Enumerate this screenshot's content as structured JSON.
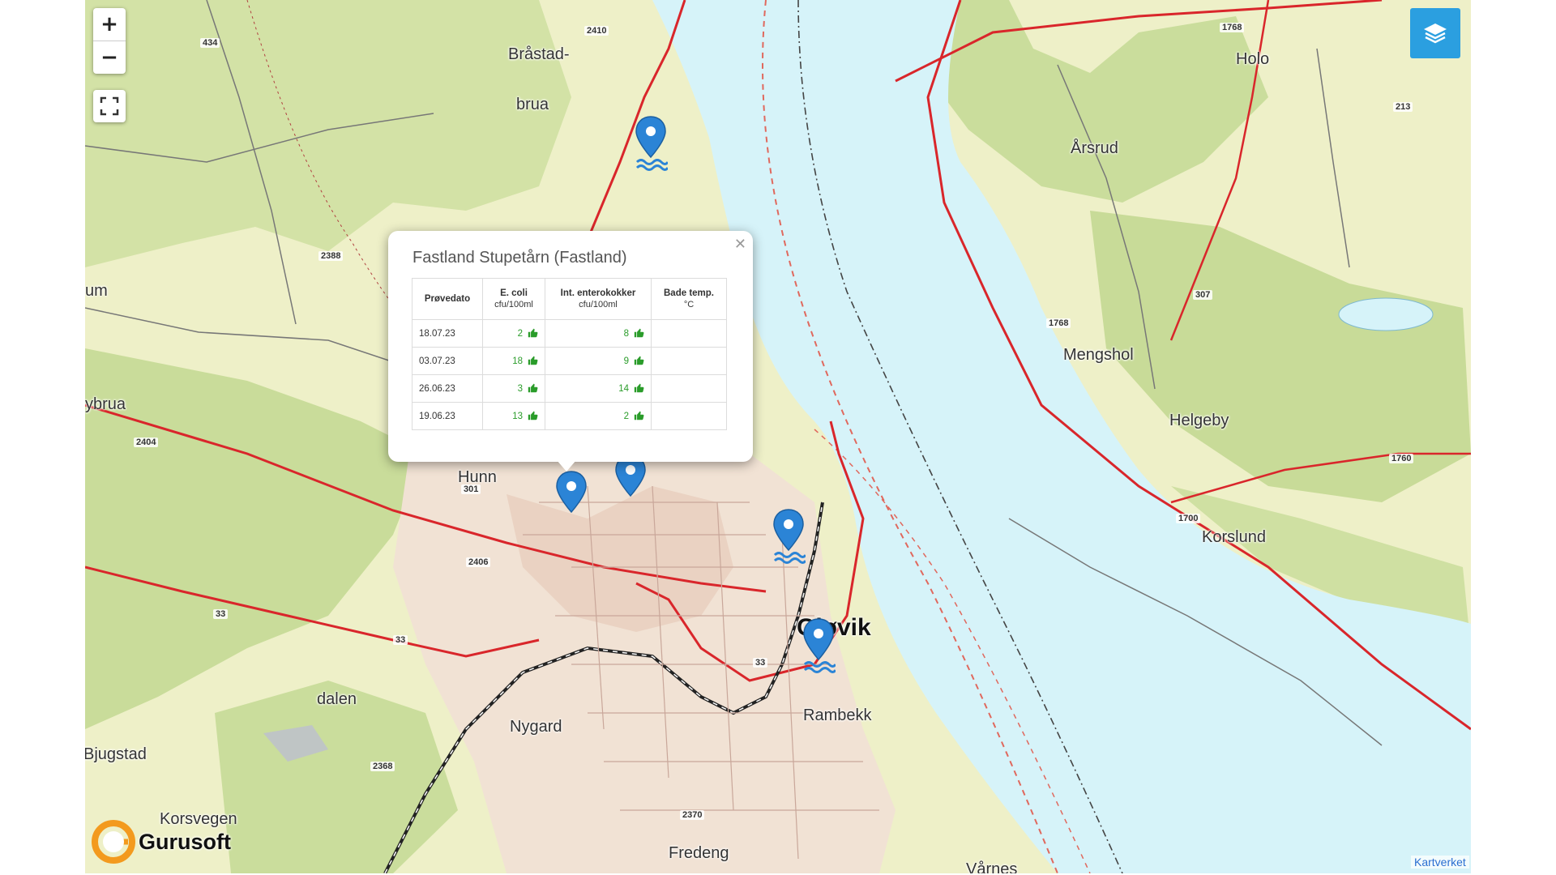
{
  "map": {
    "controls": {
      "zoom_in": "+",
      "zoom_out": "−"
    },
    "labels": {
      "brastad": "Bråstad-",
      "brua": "brua",
      "holo": "Holo",
      "arsrud": "Årsrud",
      "um": "um",
      "ybrua": "ybrua",
      "mengshol": "Mengshol",
      "helgeby": "Helgeby",
      "hunn": "Hunn",
      "korslund": "Korslund",
      "gjovik": "Gjøvik",
      "rambekk": "Rambekk",
      "dalen": "dalen",
      "nygard": "Nygard",
      "bjugstad": "Bjugstad",
      "korsvegen": "Korsvegen",
      "fredeng": "Fredeng",
      "varnes": "Vårnes"
    },
    "road_numbers": {
      "r2410": "2410",
      "r434": "434",
      "r1768a": "1768",
      "r213": "213",
      "r2388": "2388",
      "r307": "307",
      "r1768b": "1768",
      "r2404": "2404",
      "r301": "301",
      "r1760": "1760",
      "r1700": "1700",
      "r2406": "2406",
      "r33a": "33",
      "r33b": "33",
      "r33c": "33",
      "r2368": "2368",
      "r2370": "2370"
    },
    "attribution": "Kartverket",
    "logo_text": "Gurusoft"
  },
  "popup": {
    "title": "Fastland Stupetårn (Fastland)",
    "columns": [
      {
        "label": "Prøvedato",
        "unit": ""
      },
      {
        "label": "E. coli",
        "unit": "cfu/100ml"
      },
      {
        "label": "Int. enterokokker",
        "unit": "cfu/100ml"
      },
      {
        "label": "Bade temp.",
        "unit": "°C"
      }
    ],
    "rows": [
      {
        "date": "18.07.23",
        "ecoli": "2",
        "entero": "8",
        "temp": ""
      },
      {
        "date": "03.07.23",
        "ecoli": "18",
        "entero": "9",
        "temp": ""
      },
      {
        "date": "26.06.23",
        "ecoli": "3",
        "entero": "14",
        "temp": ""
      },
      {
        "date": "19.06.23",
        "ecoli": "13",
        "entero": "2",
        "temp": ""
      }
    ],
    "good_status_color": "#2a9c2a"
  },
  "colors": {
    "water": "#d6f3f9",
    "land": "#eef0c8",
    "forest": "#c9dc9a",
    "road_main": "#d9262b",
    "marker": "#2b84d6",
    "accent": "#2b9fe0"
  }
}
